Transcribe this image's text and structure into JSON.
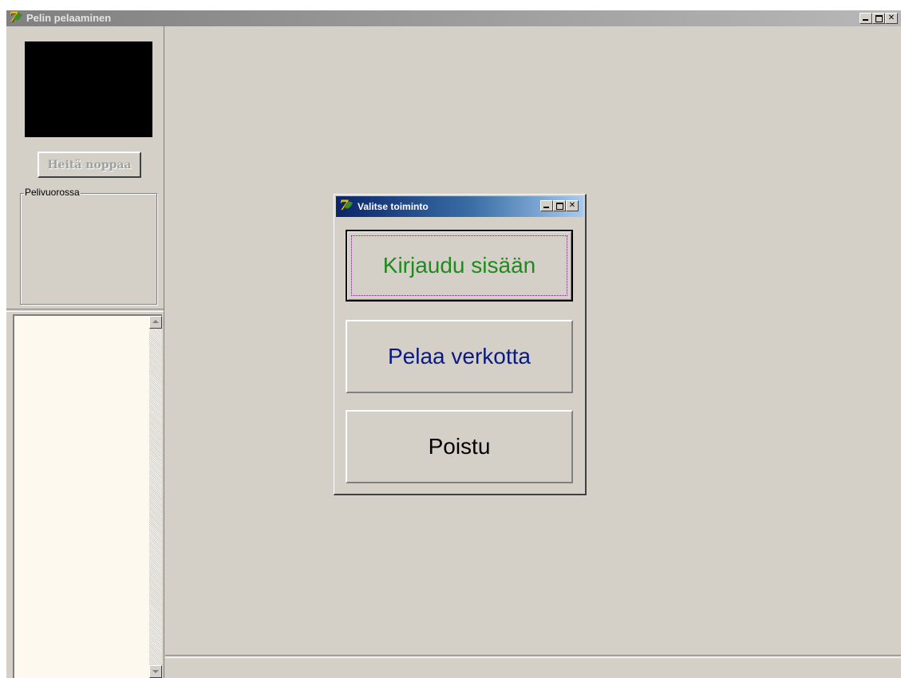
{
  "main_window": {
    "title": "Pelin pelaaminen",
    "icon": "app-logo-icon"
  },
  "left_panel": {
    "throw_button_label": "Heitä noppaa",
    "turn_group_label": "Pelivuorossa"
  },
  "dialog": {
    "title": "Valitse toiminto",
    "buttons": {
      "login": "Kirjaudu sisään",
      "play_online": "Pelaa verkotta",
      "quit": "Poistu"
    }
  },
  "colors": {
    "login_text": "#1f8a1f",
    "online_text": "#0a1a80",
    "quit_text": "#000000",
    "log_background": "#fdf9ee",
    "dialog_titlebar": "#0a246a"
  }
}
